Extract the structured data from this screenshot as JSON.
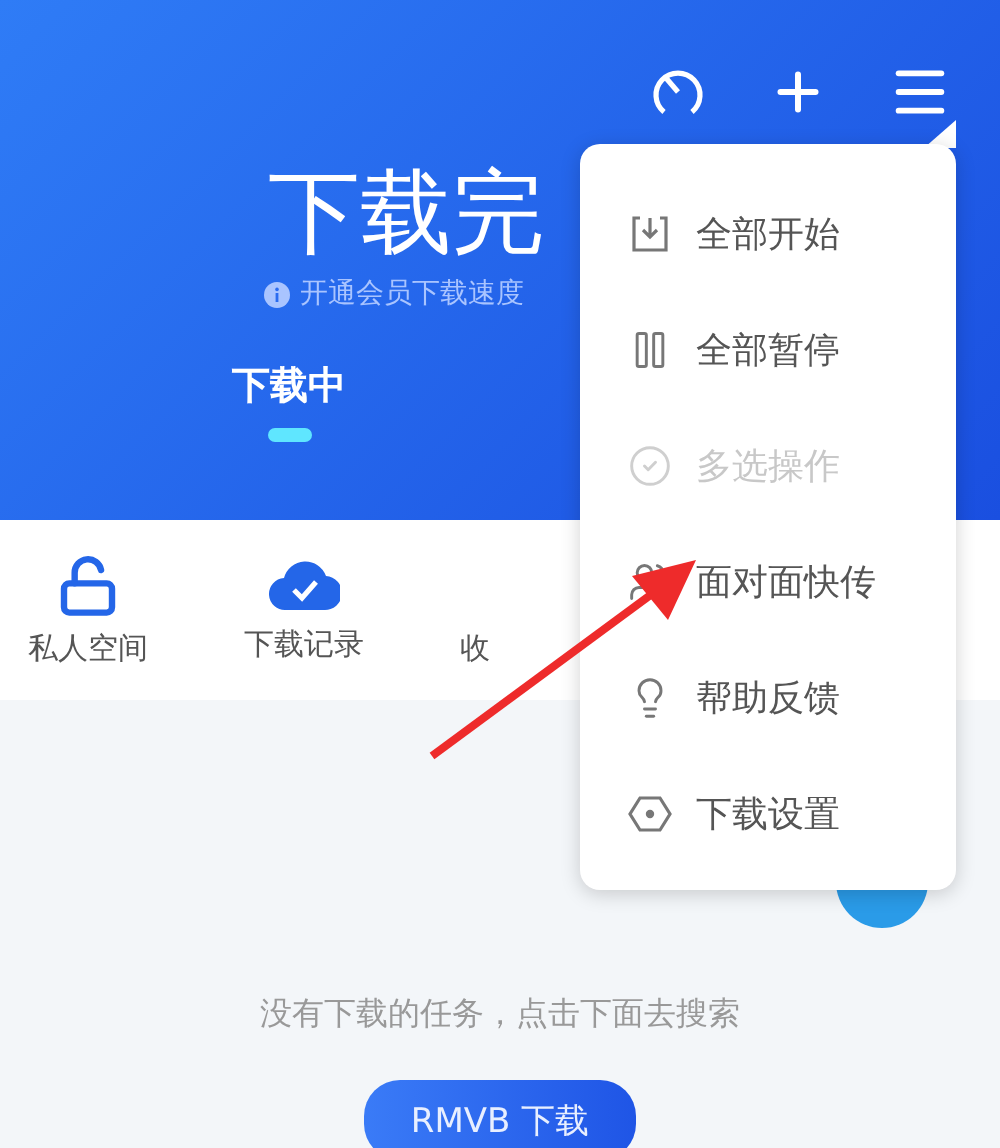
{
  "header": {
    "title": "下载完",
    "notice": "开通会员下载速度"
  },
  "tabs": [
    {
      "label": "下载中",
      "selected": true
    }
  ],
  "shortcuts": [
    {
      "kind": "lock",
      "label": "私人空间"
    },
    {
      "kind": "cloud",
      "label": "下载记录"
    },
    {
      "kind": "hidden",
      "label": "收"
    }
  ],
  "menu": [
    {
      "kind": "start",
      "label": "全部开始",
      "disabled": false
    },
    {
      "kind": "pause",
      "label": "全部暂停",
      "disabled": false
    },
    {
      "kind": "select",
      "label": "多选操作",
      "disabled": true
    },
    {
      "kind": "share",
      "label": "面对面快传",
      "disabled": false
    },
    {
      "kind": "help",
      "label": "帮助反馈",
      "disabled": false
    },
    {
      "kind": "settings",
      "label": "下载设置",
      "disabled": false
    }
  ],
  "empty": {
    "message": "没有下载的任务，点击下面去搜索",
    "button": "RMVB 下载"
  }
}
